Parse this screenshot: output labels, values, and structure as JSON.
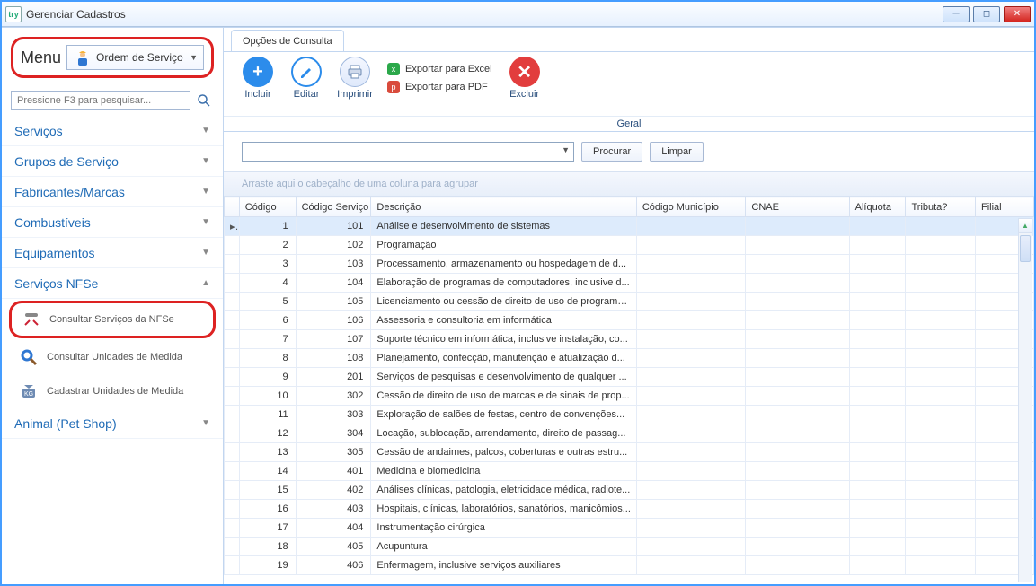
{
  "window": {
    "title": "Gerenciar Cadastros",
    "app_badge": "try"
  },
  "sidebar": {
    "menu_label": "Menu",
    "menu_combo_value": "Ordem de Serviço",
    "search_placeholder": "Pressione F3 para pesquisar...",
    "items": [
      {
        "label": "Serviços",
        "expanded": false
      },
      {
        "label": "Grupos de Serviço",
        "expanded": false
      },
      {
        "label": "Fabricantes/Marcas",
        "expanded": false
      },
      {
        "label": "Combustíveis",
        "expanded": false
      },
      {
        "label": "Equipamentos",
        "expanded": false
      },
      {
        "label": "Serviços NFSe",
        "expanded": true
      },
      {
        "label": "Animal (Pet Shop)",
        "expanded": false
      }
    ],
    "nfse_subitems": [
      {
        "label": "Consultar Serviços da NFSe",
        "highlighted": true
      },
      {
        "label": "Consultar Unidades de Medida",
        "highlighted": false
      },
      {
        "label": "Cadastrar Unidades de Medida",
        "highlighted": false
      }
    ]
  },
  "ribbon": {
    "tab_label": "Opções de Consulta",
    "buttons": {
      "incluir": "Incluir",
      "editar": "Editar",
      "imprimir": "Imprimir",
      "excluir": "Excluir",
      "export_excel": "Exportar para Excel",
      "export_pdf": "Exportar para PDF"
    },
    "group_label": "Geral"
  },
  "filter": {
    "combo_value": "",
    "procurar": "Procurar",
    "limpar": "Limpar"
  },
  "grid": {
    "group_hint": "Arraste aqui o cabeçalho de uma coluna para agrupar",
    "columns": [
      "Código",
      "Código Serviço",
      "Descrição",
      "Código Município",
      "CNAE",
      "Alíquota",
      "Tributa?",
      "Filial"
    ],
    "rows": [
      {
        "codigo": 1,
        "cod_serv": 101,
        "descricao": "Análise e desenvolvimento de sistemas",
        "selected": true
      },
      {
        "codigo": 2,
        "cod_serv": 102,
        "descricao": "Programação"
      },
      {
        "codigo": 3,
        "cod_serv": 103,
        "descricao": "Processamento, armazenamento ou hospedagem de d..."
      },
      {
        "codigo": 4,
        "cod_serv": 104,
        "descricao": "Elaboração de programas de computadores, inclusive d..."
      },
      {
        "codigo": 5,
        "cod_serv": 105,
        "descricao": "Licenciamento ou cessão de direito de uso de programa..."
      },
      {
        "codigo": 6,
        "cod_serv": 106,
        "descricao": "Assessoria e consultoria em informática"
      },
      {
        "codigo": 7,
        "cod_serv": 107,
        "descricao": "Suporte técnico em informática, inclusive instalação, co..."
      },
      {
        "codigo": 8,
        "cod_serv": 108,
        "descricao": "Planejamento, confecção, manutenção e atualização d..."
      },
      {
        "codigo": 9,
        "cod_serv": 201,
        "descricao": "Serviços de pesquisas e desenvolvimento de qualquer ..."
      },
      {
        "codigo": 10,
        "cod_serv": 302,
        "descricao": "Cessão de direito de uso de marcas e de sinais de prop..."
      },
      {
        "codigo": 11,
        "cod_serv": 303,
        "descricao": "Exploração de salões de festas, centro de convenções..."
      },
      {
        "codigo": 12,
        "cod_serv": 304,
        "descricao": "Locação, sublocação, arrendamento, direito de passag..."
      },
      {
        "codigo": 13,
        "cod_serv": 305,
        "descricao": "Cessão de andaimes, palcos, coberturas e outras estru..."
      },
      {
        "codigo": 14,
        "cod_serv": 401,
        "descricao": "Medicina e biomedicina"
      },
      {
        "codigo": 15,
        "cod_serv": 402,
        "descricao": "Análises clínicas, patologia, eletricidade médica, radiote..."
      },
      {
        "codigo": 16,
        "cod_serv": 403,
        "descricao": "Hospitais, clínicas, laboratórios, sanatórios, manicômios..."
      },
      {
        "codigo": 17,
        "cod_serv": 404,
        "descricao": "Instrumentação cirúrgica"
      },
      {
        "codigo": 18,
        "cod_serv": 405,
        "descricao": "Acupuntura"
      },
      {
        "codigo": 19,
        "cod_serv": 406,
        "descricao": "Enfermagem, inclusive serviços auxiliares"
      }
    ]
  }
}
